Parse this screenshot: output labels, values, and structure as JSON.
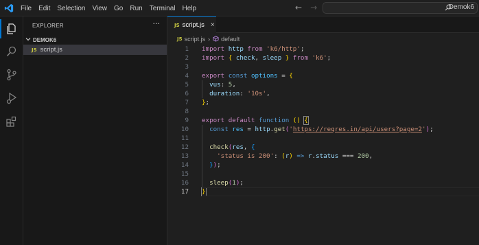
{
  "menu": [
    "File",
    "Edit",
    "Selection",
    "View",
    "Go",
    "Run",
    "Terminal",
    "Help"
  ],
  "search": {
    "text": "Demok6"
  },
  "sidebar": {
    "title": "EXPLORER",
    "more": "···",
    "folder": "DEMOK6",
    "file": "script.js"
  },
  "tab": {
    "label": "script.js",
    "close": "×"
  },
  "file_badge": "JS",
  "breadcrumb": {
    "file": "script.js",
    "symbol": "default"
  },
  "code": {
    "line_numbers": [
      "1",
      "2",
      "3",
      "4",
      "5",
      "6",
      "7",
      "8",
      "9",
      "10",
      "11",
      "12",
      "13",
      "14",
      "15",
      "16",
      "17"
    ],
    "lines": [
      [
        [
          "kw",
          "import "
        ],
        [
          "var",
          "http"
        ],
        [
          "kw",
          " from "
        ],
        [
          "str",
          "'k6/http'"
        ],
        [
          "op",
          ";"
        ]
      ],
      [
        [
          "kw",
          "import "
        ],
        [
          "br1",
          "{ "
        ],
        [
          "var",
          "check"
        ],
        [
          "op",
          ", "
        ],
        [
          "var",
          "sleep"
        ],
        [
          "br1",
          " }"
        ],
        [
          "kw",
          " from "
        ],
        [
          "str",
          "'k6'"
        ],
        [
          "op",
          ";"
        ]
      ],
      [],
      [
        [
          "kw",
          "export "
        ],
        [
          "kb",
          "const "
        ],
        [
          "const",
          "options"
        ],
        [
          "op",
          " = "
        ],
        [
          "br1",
          "{"
        ]
      ],
      [
        [
          "op",
          "  "
        ],
        [
          "var",
          "vus"
        ],
        [
          "op",
          ": "
        ],
        [
          "num",
          "5"
        ],
        [
          "op",
          ","
        ]
      ],
      [
        [
          "op",
          "  "
        ],
        [
          "var",
          "duration"
        ],
        [
          "op",
          ": "
        ],
        [
          "str",
          "'10s'"
        ],
        [
          "op",
          ","
        ]
      ],
      [
        [
          "br1",
          "}"
        ],
        [
          "op",
          ";"
        ]
      ],
      [],
      [
        [
          "kw",
          "export "
        ],
        [
          "kw",
          "default "
        ],
        [
          "kb",
          "function "
        ],
        [
          "br1",
          "()"
        ],
        [
          "op",
          " "
        ],
        [
          "br1",
          "{"
        ]
      ],
      [
        [
          "op",
          "  "
        ],
        [
          "kb",
          "const "
        ],
        [
          "const",
          "res"
        ],
        [
          "op",
          " = "
        ],
        [
          "var",
          "http"
        ],
        [
          "op",
          "."
        ],
        [
          "fn",
          "get"
        ],
        [
          "br2",
          "("
        ],
        [
          "str",
          "'"
        ],
        [
          "url",
          "https://reqres.in/api/users?page=2"
        ],
        [
          "str",
          "'"
        ],
        [
          "br2",
          ")"
        ],
        [
          "op",
          ";"
        ]
      ],
      [],
      [
        [
          "op",
          "  "
        ],
        [
          "fn",
          "check"
        ],
        [
          "br2",
          "("
        ],
        [
          "var",
          "res"
        ],
        [
          "op",
          ", "
        ],
        [
          "br3",
          "{"
        ]
      ],
      [
        [
          "op",
          "    "
        ],
        [
          "str",
          "'status is 200'"
        ],
        [
          "op",
          ": "
        ],
        [
          "br1",
          "("
        ],
        [
          "var",
          "r"
        ],
        [
          "br1",
          ")"
        ],
        [
          "kb",
          " => "
        ],
        [
          "var",
          "r"
        ],
        [
          "op",
          "."
        ],
        [
          "var",
          "status"
        ],
        [
          "op",
          " === "
        ],
        [
          "num",
          "200"
        ],
        [
          "op",
          ","
        ]
      ],
      [
        [
          "op",
          "  "
        ],
        [
          "br3",
          "}"
        ],
        [
          "br2",
          ")"
        ],
        [
          "op",
          ";"
        ]
      ],
      [],
      [
        [
          "op",
          "  "
        ],
        [
          "fn",
          "sleep"
        ],
        [
          "br2",
          "("
        ],
        [
          "num",
          "1"
        ],
        [
          "br2",
          ")"
        ],
        [
          "op",
          ";"
        ]
      ],
      [
        [
          "br1",
          "}"
        ]
      ]
    ]
  },
  "colors": {
    "accent": "#0078d4",
    "js_badge": "#cbcb41"
  }
}
